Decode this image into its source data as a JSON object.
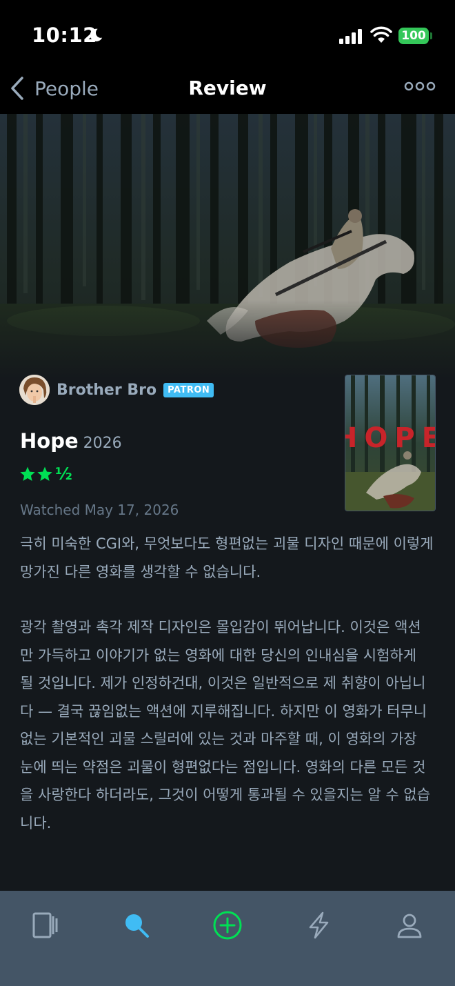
{
  "status_bar": {
    "time": "10:12",
    "battery": "100"
  },
  "nav": {
    "back_label": "People",
    "title": "Review"
  },
  "reviewer": {
    "name": "Brother Bro",
    "badge": "PATRON"
  },
  "film": {
    "title": "Hope",
    "year": "2026",
    "poster_text": "HOPE"
  },
  "rating": {
    "stars": 2.5,
    "full_stars": 2,
    "half_label": "½",
    "color": "#00e054"
  },
  "watched": "Watched May 17, 2026",
  "review": {
    "paragraphs": [
      "극히 미숙한 CGI와, 무엇보다도 형편없는 괴물 디자인 때문에 이렇게 망가진 다른 영화를 생각할 수 없습니다.",
      "광각 촬영과 촉각 제작 디자인은 몰입감이 뛰어납니다. 이것은 액션만 가득하고 이야기가 없는 영화에 대한 당신의 인내심을 시험하게 될 것입니다. 제가 인정하건대, 이것은 일반적으로 제 취향이 아닙니다 — 결국 끊임없는 액션에 지루해집니다. 하지만 이 영화가 터무니없는 기본적인 괴물 스릴러에 있는 것과 마주할 때, 이 영화의 가장 눈에 띄는 약점은 괴물이 형편없다는 점입니다. 영화의 다른 모든 것을 사랑한다 하더라도, 그것이 어떻게 통과될 수 있을지는 알 수 없습니다."
    ]
  },
  "tabs": [
    {
      "icon": "films-icon",
      "color": "#9ab"
    },
    {
      "icon": "search-icon",
      "color": "#40bcf4"
    },
    {
      "icon": "add-icon",
      "color": "#00e054"
    },
    {
      "icon": "activity-icon",
      "color": "#9ab"
    },
    {
      "icon": "profile-icon",
      "color": "#9ab"
    }
  ],
  "colors": {
    "background": "#14181c",
    "tab_bar": "#445566",
    "accent_blue": "#40bcf4",
    "accent_green": "#00e054",
    "muted_text": "#9ab"
  }
}
